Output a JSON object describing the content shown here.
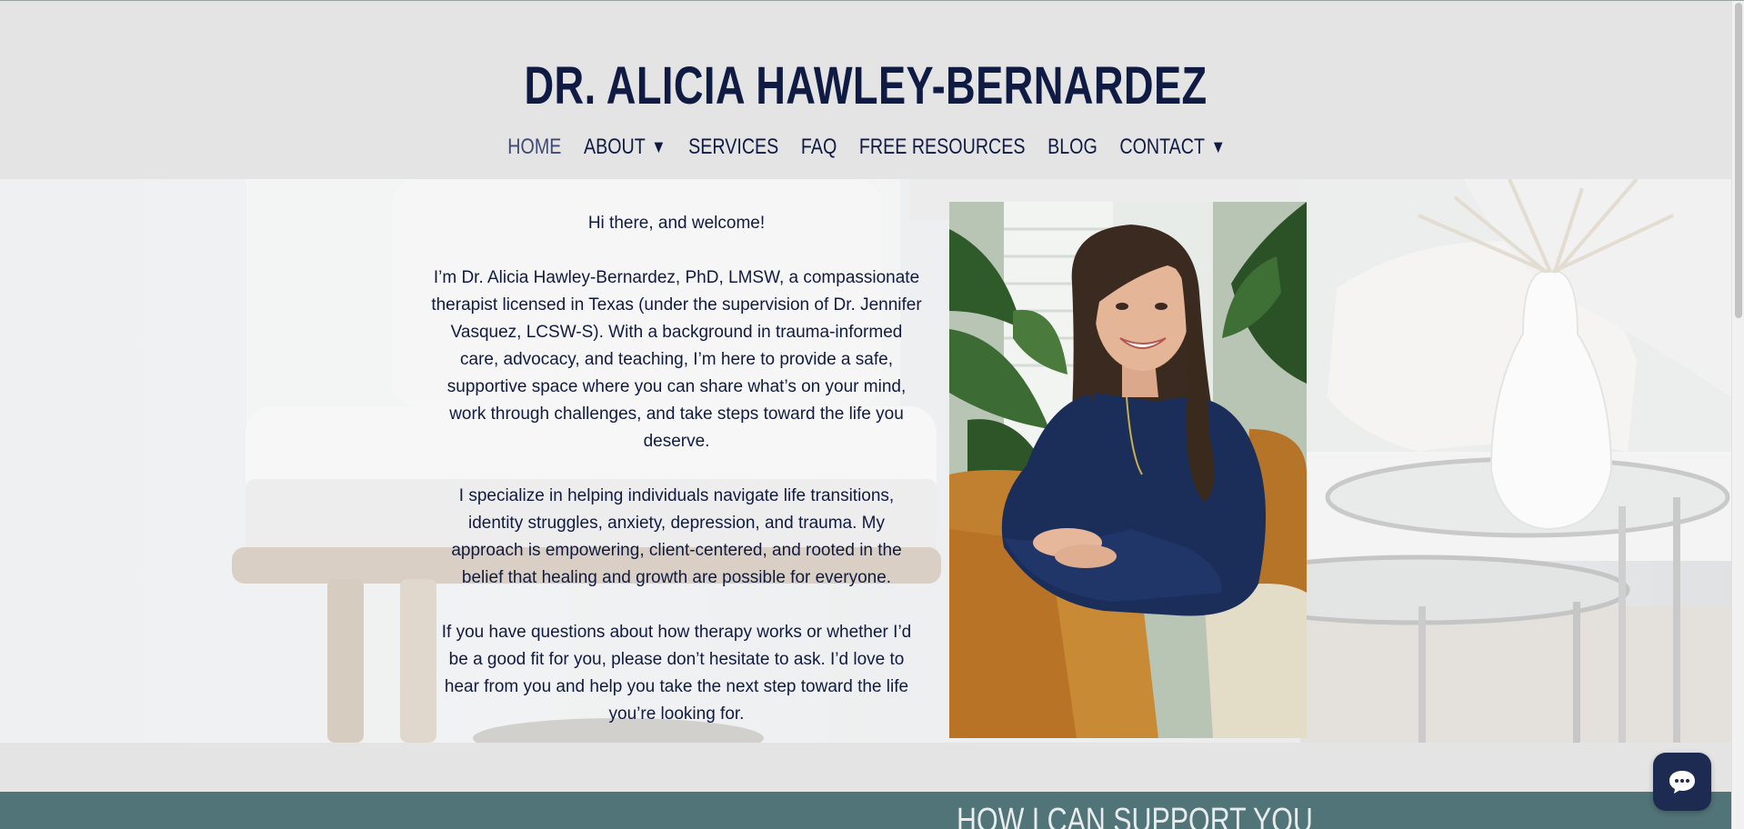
{
  "header": {
    "site_title": "DR. ALICIA HAWLEY-BERNARDEZ",
    "nav": [
      {
        "label": "HOME",
        "active": true
      },
      {
        "label": "ABOUT",
        "dropdown": true
      },
      {
        "label": "SERVICES"
      },
      {
        "label": "FAQ"
      },
      {
        "label": "FREE RESOURCES"
      },
      {
        "label": "BLOG"
      },
      {
        "label": "CONTACT",
        "dropdown": true
      }
    ],
    "dropdown_glyph": "▼"
  },
  "intro": {
    "greeting": "Hi there, and welcome!",
    "paragraph_1": "I’m Dr. Alicia Hawley-Bernardez, PhD, LMSW, a compassionate therapist licensed in Texas (under the supervision of Dr. Jennifer Vasquez, LCSW-S). With a background in trauma-informed care, advocacy, and teaching, I’m here to provide a safe, supportive space where you can share what’s on your mind, work through challenges, and take steps toward the life you deserve.",
    "paragraph_2": "I specialize in helping individuals navigate life transitions, identity struggles, anxiety, depression, and trauma. My approach is empowering, client-centered, and rooted in the belief that healing and growth are possible for everyone.",
    "paragraph_3": "If you have questions about how therapy works or whether I’d be a good fit for you, please don’t hesitate to ask. I’d love to hear from you and help you take the next step toward the life you’re looking for."
  },
  "support_section": {
    "title": "HOW I CAN SUPPORT YOU"
  },
  "chat": {
    "icon": "chat-bubble-icon"
  },
  "colors": {
    "navy": "#101b44",
    "band_teal": "#517478",
    "header_bg": "#e4e4e4"
  }
}
